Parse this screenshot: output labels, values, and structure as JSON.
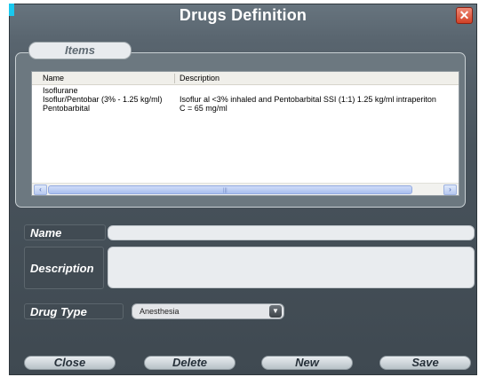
{
  "window": {
    "title": "Drugs Definition",
    "close_glyph": "✕"
  },
  "items": {
    "group_label": "Items",
    "columns": [
      "Name",
      "Description"
    ],
    "rows": [
      {
        "name": "Isoflurane",
        "description": ""
      },
      {
        "name": "Isoflur/Pentobar (3% - 1.25 kg/ml)",
        "description": "Isoflur al <3% inhaled and Pentobarbital  SSI (1:1) 1.25 kg/ml intraperiton"
      },
      {
        "name": "Pentobarbital",
        "description": "C = 65 mg/ml"
      }
    ],
    "scroll": {
      "left_glyph": "‹",
      "right_glyph": "›",
      "grip_glyph": "|||"
    }
  },
  "form": {
    "name_label": "Name",
    "name_value": "",
    "description_label": "Description",
    "description_value": "",
    "drug_type_label": "Drug Type",
    "drug_type_value": "Anesthesia",
    "dropdown_glyph": "▼"
  },
  "buttons": {
    "close": "Close",
    "delete": "Delete",
    "new": "New",
    "save": "Save"
  },
  "colors": {
    "accent": "#19c8ee",
    "close_button": "#d24126"
  }
}
